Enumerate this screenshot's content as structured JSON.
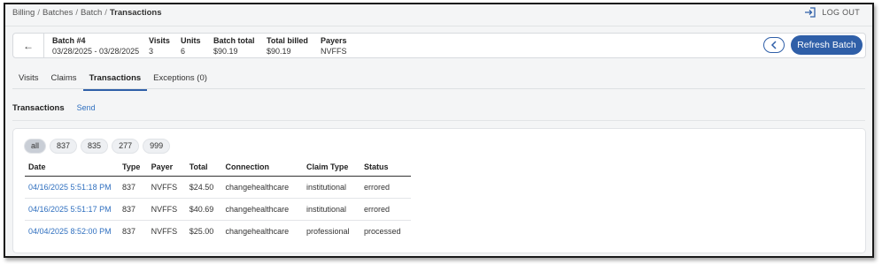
{
  "breadcrumb": {
    "items": [
      "Billing",
      "Batches",
      "Batch"
    ],
    "separator": "/",
    "current": "Transactions"
  },
  "header": {
    "logout_label": "LOG OUT",
    "logout_icon": "logout-icon"
  },
  "batch": {
    "back_icon": "←",
    "name": {
      "label": "Batch #4",
      "value": "03/28/2025 - 03/28/2025"
    },
    "visits": {
      "label": "Visits",
      "value": "3"
    },
    "units": {
      "label": "Units",
      "value": "6"
    },
    "batch_total": {
      "label": "Batch total",
      "value": "$90.19"
    },
    "total_billed": {
      "label": "Total billed",
      "value": "$90.19"
    },
    "payers": {
      "label": "Payers",
      "value": "NVFFS"
    },
    "refresh_label": "Refresh Batch",
    "accent_color": "#2f5fa8"
  },
  "tabs": [
    {
      "label": "Visits",
      "active": false
    },
    {
      "label": "Claims",
      "active": false
    },
    {
      "label": "Transactions",
      "active": true
    },
    {
      "label": "Exceptions (0)",
      "active": false
    }
  ],
  "section": {
    "title": "Transactions",
    "send_label": "Send"
  },
  "filters": [
    {
      "label": "all",
      "active": true
    },
    {
      "label": "837",
      "active": false
    },
    {
      "label": "835",
      "active": false
    },
    {
      "label": "277",
      "active": false
    },
    {
      "label": "999",
      "active": false
    }
  ],
  "table": {
    "columns": [
      "Date",
      "Type",
      "Payer",
      "Total",
      "Connection",
      "Claim Type",
      "Status"
    ],
    "rows": [
      [
        "04/16/2025 5:51:18 PM",
        "837",
        "NVFFS",
        "$24.50",
        "changehealthcare",
        "institutional",
        "errored"
      ],
      [
        "04/16/2025 5:51:17 PM",
        "837",
        "NVFFS",
        "$40.69",
        "changehealthcare",
        "institutional",
        "errored"
      ],
      [
        "04/04/2025 8:52:00 PM",
        "837",
        "NVFFS",
        "$25.00",
        "changehealthcare",
        "professional",
        "processed"
      ]
    ]
  }
}
